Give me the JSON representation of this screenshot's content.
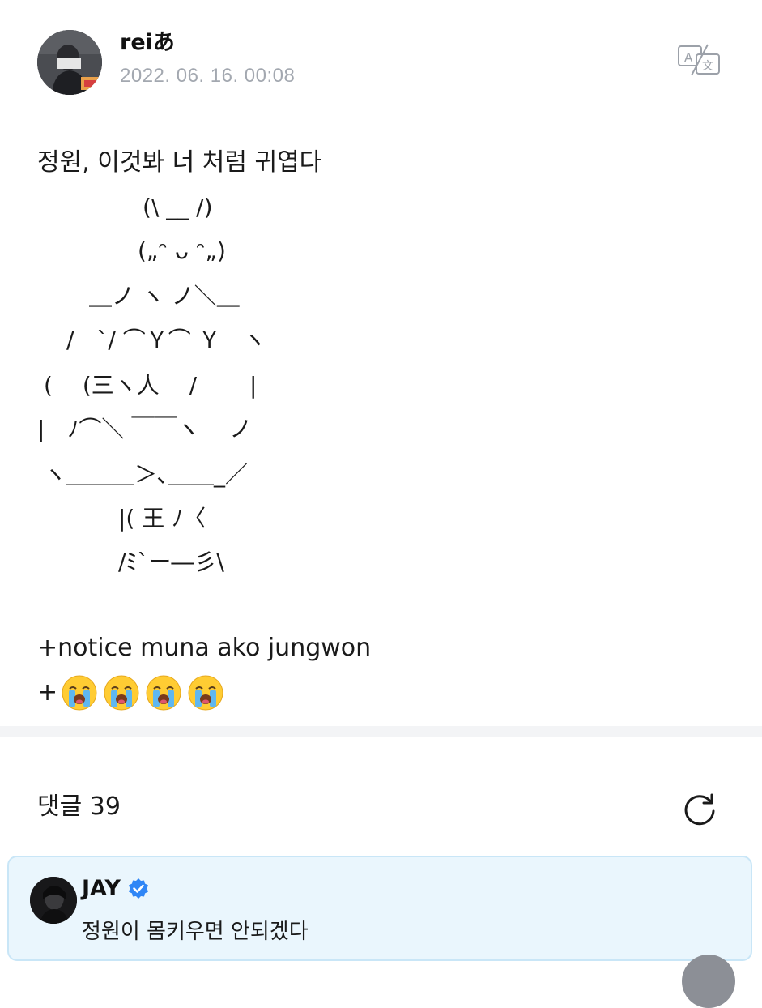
{
  "post": {
    "author": "reiあ",
    "timestamp": "2022. 06. 16. 00:08",
    "body_first_line": "정원, 이것봐 너 처럼 귀엽다",
    "ascii_art": [
      "(\\ __ /)",
      "(„ᵔ ᴗ ᵔ„)",
      "＿ノ ヽ ノ＼＿",
      "/　`/ ⌒Ｙ⌒ Ｙ　ヽ",
      "( 　(三ヽ人　 /　 　|",
      "|　ﾉ⌒＼ ￣￣ヽ　 ノ",
      "ヽ＿＿＿＞､＿＿_／",
      "|( 王 ﾉ〈",
      "/ﾐ`ー―彡\\"
    ],
    "notice_line": "+notice muna ako jungwon",
    "emoji_prefix": "+",
    "emoji_count": 4,
    "translate_icon": "translate-icon"
  },
  "comments": {
    "title": "댓글 39",
    "refresh_icon": "refresh-icon",
    "items": [
      {
        "author": "JAY",
        "verified": true,
        "text": "정원이 몸키우면 안되겠다"
      }
    ]
  },
  "colors": {
    "timestamp": "#a3a8b0",
    "divider": "#f3f4f6",
    "comment_bg": "#eaf6fd",
    "comment_border": "#c9e6f7",
    "verified": "#2f86f6"
  }
}
